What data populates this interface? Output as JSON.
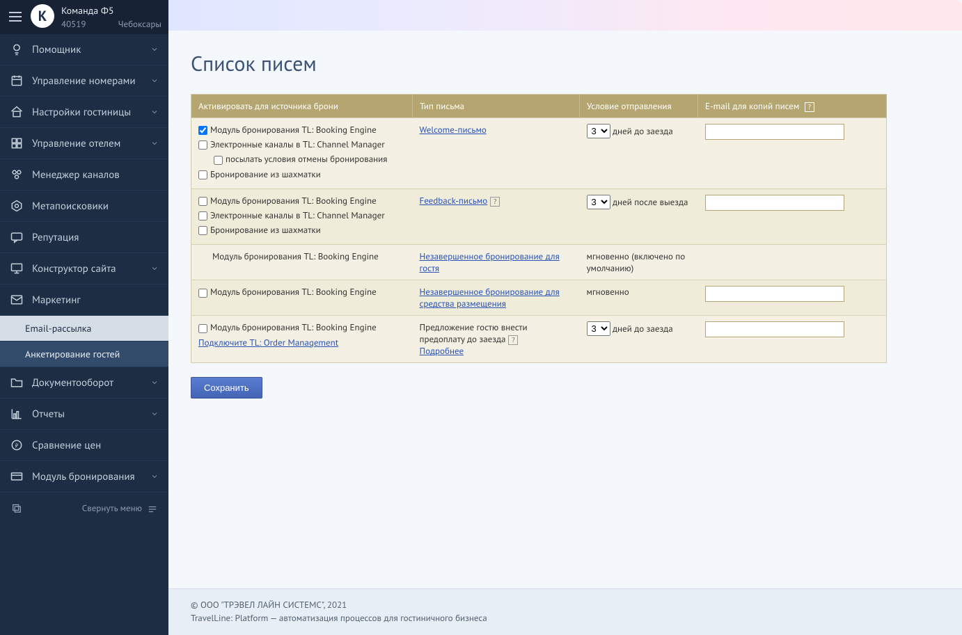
{
  "header": {
    "team_name": "Команда Ф5",
    "account_id": "40519",
    "city": "Чебоксары"
  },
  "nav": {
    "items": [
      {
        "label": "Помощник",
        "icon": "lightbulb",
        "expandable": true
      },
      {
        "label": "Управление номерами",
        "icon": "calendar",
        "expandable": true
      },
      {
        "label": "Настройки гостиницы",
        "icon": "home",
        "expandable": true
      },
      {
        "label": "Управление отелем",
        "icon": "grid",
        "expandable": true
      },
      {
        "label": "Менеджер каналов",
        "icon": "gear-cluster",
        "expandable": false
      },
      {
        "label": "Метапоисковики",
        "icon": "hexagon",
        "expandable": false
      },
      {
        "label": "Репутация",
        "icon": "chat",
        "expandable": false
      },
      {
        "label": "Конструктор сайта",
        "icon": "monitor",
        "expandable": true
      },
      {
        "label": "Маркетинг",
        "icon": "envelope",
        "expandable": false
      },
      {
        "label": "Документооборот",
        "icon": "folder",
        "expandable": true
      },
      {
        "label": "Отчеты",
        "icon": "chart",
        "expandable": true
      },
      {
        "label": "Сравнение цен",
        "icon": "coin",
        "expandable": false
      },
      {
        "label": "Модуль бронирования",
        "icon": "card",
        "expandable": true
      }
    ],
    "marketing_sub": [
      {
        "label": "Email-рассылка",
        "state": "active"
      },
      {
        "label": "Анкетирование гостей",
        "state": "highlighted"
      }
    ],
    "collapse_label": "Свернуть меню"
  },
  "page": {
    "title": "Список писем",
    "columns": {
      "c1": "Активировать для источника брони",
      "c2": "Тип письма",
      "c3": "Условие отправления",
      "c4": "E-mail для копий писем"
    },
    "rows": [
      {
        "sources": [
          {
            "label": "Модуль бронирования TL: Booking Engine",
            "checked": true
          },
          {
            "label": "Электронные каналы в TL: Channel Manager",
            "checked": false
          },
          {
            "label": "посылать условия отмены бронирования",
            "checked": false,
            "indent": true
          },
          {
            "label": "Бронирование из шахматки",
            "checked": false
          }
        ],
        "type_link": "Welcome-письмо",
        "type_help": false,
        "condition_select": "3",
        "condition_suffix": "дней  до заезда",
        "email_input": true
      },
      {
        "sources": [
          {
            "label": "Модуль бронирования TL: Booking Engine",
            "checked": false
          },
          {
            "label": "Электронные каналы в TL: Channel Manager",
            "checked": false
          },
          {
            "label": "Бронирование из шахматки",
            "checked": false
          }
        ],
        "type_link": "Feedback-письмо",
        "type_help": true,
        "condition_select": "3",
        "condition_suffix": "дней после выезда",
        "email_input": true
      },
      {
        "sources": [
          {
            "label": "Модуль бронирования TL: Booking Engine",
            "checked": false,
            "no_cb": true
          }
        ],
        "type_link": "Незавершенное бронирование для гостя",
        "type_help": false,
        "condition_text": "мгновенно (включено по умолчанию)",
        "email_input": false
      },
      {
        "sources": [
          {
            "label": "Модуль бронирования TL: Booking Engine",
            "checked": false
          }
        ],
        "type_link": "Незавершенное бронирование для средства размещения",
        "type_help": false,
        "condition_text": "мгновенно",
        "email_input": true
      },
      {
        "sources": [
          {
            "label": "Модуль бронирования TL: Booking Engine",
            "checked": false
          }
        ],
        "extra_link": "Подключите TL: Order Management",
        "type_plain": "Предложение гостю внести предоплату до заезда",
        "type_help": true,
        "type_more_link": "Подробнее",
        "condition_select": "3",
        "condition_suffix": "дней  до заезда",
        "email_input": true
      }
    ],
    "save_label": "Сохранить"
  },
  "footer": {
    "line1": "© ООО \"ТРЭВЕЛ ЛАЙН СИСТЕМС\", 2021",
    "line2": "TravelLine: Platform — автоматизация процессов для гостиничного бизнеса"
  }
}
